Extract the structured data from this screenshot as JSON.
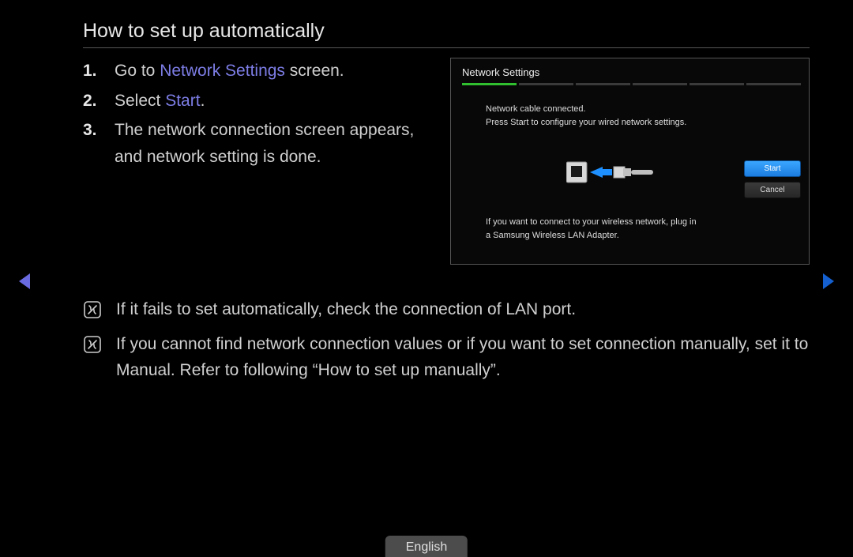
{
  "title": "How to set up automatically",
  "steps": [
    {
      "num": "1.",
      "pre": "Go to ",
      "hl": "Network Settings",
      "post": " screen."
    },
    {
      "num": "2.",
      "pre": "Select ",
      "hl": "Start",
      "post": "."
    },
    {
      "num": "3.",
      "pre": "The network connection screen appears, and network setting is done.",
      "hl": "",
      "post": ""
    }
  ],
  "panel": {
    "title": "Network Settings",
    "msg_line1": "Network cable connected.",
    "msg_line2": "Press Start to configure your wired network settings.",
    "hint_line1": "If you want to connect to your wireless network, plug in",
    "hint_line2": "a Samsung Wireless LAN Adapter.",
    "start_label": "Start",
    "cancel_label": "Cancel"
  },
  "notes": [
    "If it fails to set automatically, check the connection of LAN port.",
    "If you cannot find network connection values or if you want to set connection manually, set it to Manual. Refer to following “How to set up manually”."
  ],
  "language": "English",
  "colors": {
    "highlight": "#7d7de6",
    "seg_active": "#2fbf2f",
    "btn_start": "#2b8ff0"
  }
}
